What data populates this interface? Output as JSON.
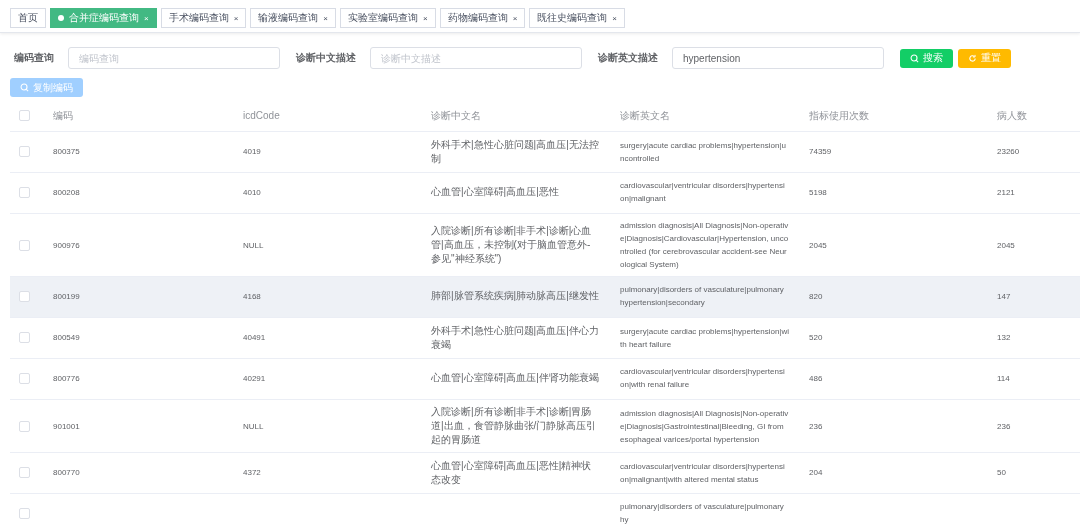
{
  "tabs": [
    {
      "label": "首页",
      "selected": false,
      "closable": false
    },
    {
      "label": "合并症编码查询",
      "selected": true,
      "closable": true
    },
    {
      "label": "手术编码查询",
      "selected": false,
      "closable": true
    },
    {
      "label": "输液编码查询",
      "selected": false,
      "closable": true
    },
    {
      "label": "实验室编码查询",
      "selected": false,
      "closable": true
    },
    {
      "label": "药物编码查询",
      "selected": false,
      "closable": true
    },
    {
      "label": "既往史编码查询",
      "selected": false,
      "closable": true
    }
  ],
  "close_glyph": "×",
  "filters": [
    {
      "label": "编码查询",
      "placeholder": "编码查询"
    },
    {
      "label": "诊断中文描述",
      "placeholder": "诊断中文描述"
    },
    {
      "label": "诊断英文描述",
      "value": "hypertension"
    }
  ],
  "buttons": [
    {
      "kind": "search",
      "label": "搜索"
    },
    {
      "kind": "reset",
      "label": "重置"
    }
  ],
  "copy_button": {
    "label": "复制编码",
    "disabled": true
  },
  "table": {
    "all_checked": false,
    "columns": [
      "编码",
      "icdCode",
      "诊断中文名",
      "诊断英文名",
      "指标使用次数",
      "病人数"
    ],
    "rows": [
      {
        "cells": [
          "800375",
          "4019",
          "外科手术|急性心脏问题|高血压|无法控制",
          "surgery|acute cardiac problems|hypertension|uncontrolled",
          "74359",
          "23260"
        ],
        "checked": false,
        "highlighted": false
      },
      {
        "cells": [
          "800208",
          "4010",
          "心血管|心室障碍|高血压|恶性",
          "cardiovascular|ventricular disorders|hypertension|malignant",
          "5198",
          "2121"
        ],
        "checked": false,
        "highlighted": false
      },
      {
        "cells": [
          "900976",
          "NULL",
          "入院诊断|所有诊断|非手术|诊断|心血管|高血压，未控制(对于脑血管意外-参见\"神经系统\")",
          "admission diagnosis|All Diagnosis|Non-operative|Diagnosis|Cardiovascular|Hypertension, uncontrolled (for cerebrovascular accident-see Neurological System)",
          "2045",
          "2045"
        ],
        "checked": false,
        "highlighted": false
      },
      {
        "cells": [
          "800199",
          "4168",
          "肺部|脉管系统疾病|肺动脉高压|继发性",
          "pulmonary|disorders of vasculature|pulmonary hypertension|secondary",
          "820",
          "147"
        ],
        "checked": false,
        "highlighted": true
      },
      {
        "cells": [
          "800549",
          "40491",
          "外科手术|急性心脏问题|高血压|伴心力衰竭",
          "surgery|acute cardiac problems|hypertension|with heart failure",
          "520",
          "132"
        ],
        "checked": false,
        "highlighted": false
      },
      {
        "cells": [
          "800776",
          "40291",
          "心血管|心室障碍|高血压|伴肾功能衰竭",
          "cardiovascular|ventricular disorders|hypertension|with renal failure",
          "486",
          "114"
        ],
        "checked": false,
        "highlighted": false
      },
      {
        "cells": [
          "901001",
          "NULL",
          "入院诊断|所有诊断|非手术|诊断|胃肠道|出血，食管静脉曲张/门静脉高压引起的胃肠道",
          "admission diagnosis|All Diagnosis|Non-operative|Diagnosis|Gastrointestinal|Bleeding, GI from esophageal varices/portal hypertension",
          "236",
          "236"
        ],
        "checked": false,
        "highlighted": false
      },
      {
        "cells": [
          "800770",
          "4372",
          "心血管|心室障碍|高血压|恶性|精神状态改变",
          "cardiovascular|ventricular disorders|hypertension|malignant|with altered mental status",
          "204",
          "50"
        ],
        "checked": false,
        "highlighted": false
      },
      {
        "cells": [
          "",
          "",
          "",
          "pulmonary|disorders of vasculature|pulmonary hy",
          "",
          ""
        ],
        "checked": false,
        "highlighted": false
      }
    ]
  }
}
